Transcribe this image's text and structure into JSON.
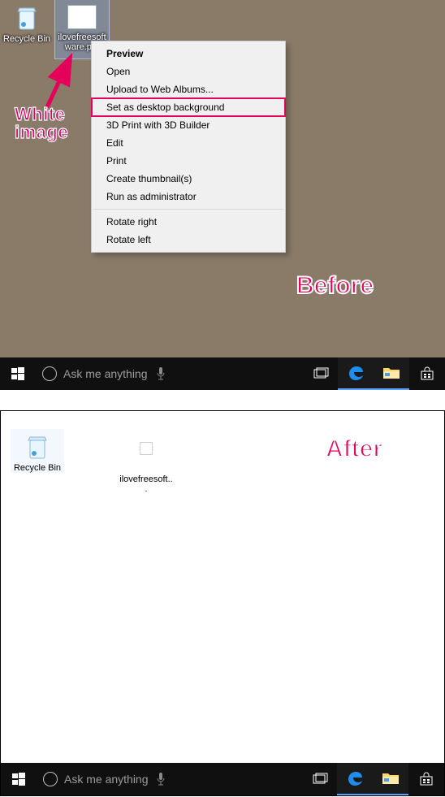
{
  "annotations": {
    "white_image_line1": "White",
    "white_image_line2": "image",
    "before": "Before",
    "after": "After"
  },
  "before": {
    "bg": "#8a7b69",
    "icons": {
      "recycle_bin": "Recycle Bin",
      "white_image": "ilovefreesoftware.p..."
    },
    "context_menu": {
      "preview": "Preview",
      "open": "Open",
      "upload": "Upload to Web Albums...",
      "set_bg": "Set as desktop background",
      "print3d": "3D Print with 3D Builder",
      "edit": "Edit",
      "print": "Print",
      "thumbs": "Create thumbnail(s)",
      "run_admin": "Run as administrator",
      "rotate_r": "Rotate right",
      "rotate_l": "Rotate left"
    },
    "taskbar": {
      "search_placeholder": "Ask me anything"
    }
  },
  "after": {
    "bg": "#ffffff",
    "icons": {
      "recycle_bin": "Recycle Bin",
      "white_image": "ilovefreesoft..."
    },
    "taskbar": {
      "search_placeholder": "Ask me anything"
    }
  }
}
